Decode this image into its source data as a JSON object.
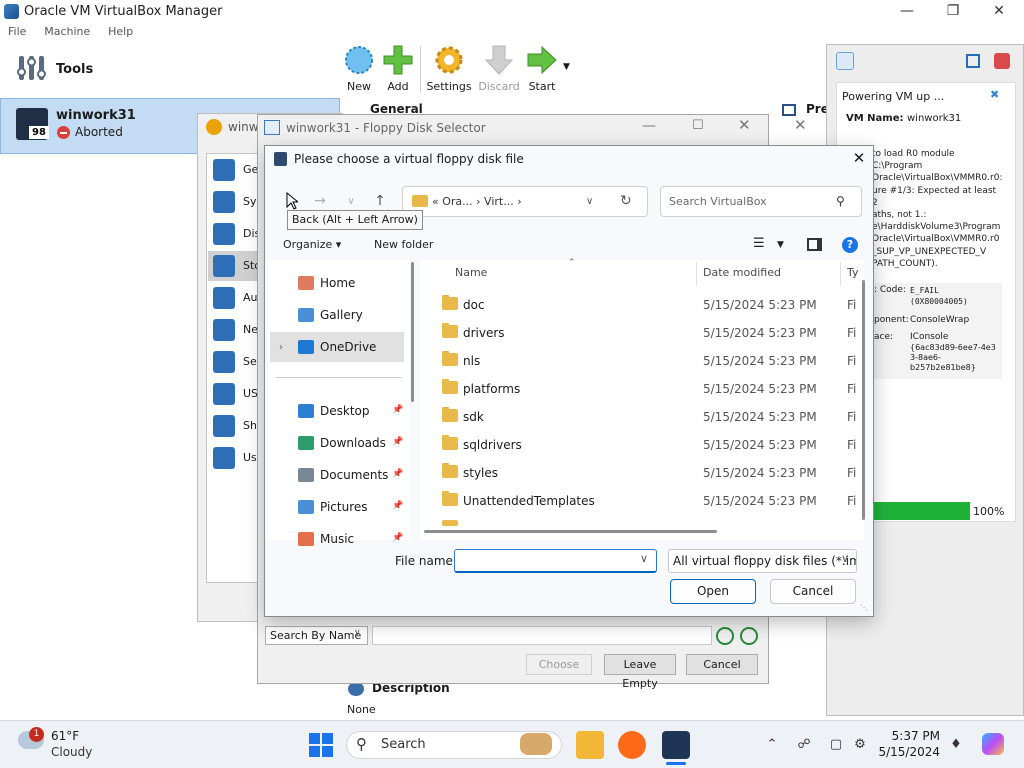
{
  "vbox": {
    "title": "Oracle VM VirtualBox Manager",
    "menu": [
      "File",
      "Machine",
      "Help"
    ],
    "tools_label": "Tools",
    "vm": {
      "name": "winwork31",
      "status": "Aborted",
      "os_badge": "98"
    },
    "toolbar": {
      "new": "New",
      "add": "Add",
      "settings": "Settings",
      "discard": "Discard",
      "start": "Start"
    },
    "general_label": "General",
    "preview_label": "Prev",
    "description_label": "Description",
    "description_value": "None"
  },
  "notification": {
    "title": "Powering VM up ...",
    "vm_label": "VM Name:",
    "vm_name": "winwork31",
    "message": "to load R0 module C:\\Program\nOracle\\VirtualBox\\VMMR0.r0:\nure #1/3: Expected at least 2\naths, not 1.:\ne\\HarddiskVolume3\\Program\nOracle\\VirtualBox\\VMMR0.r0\n_SUP_VP_UNEXPECTED_V\nPATH_COUNT).\n\nto load VMMR0.r0\n_SUP_VP_UNEXPECTED_V\nPATH_COUNT).",
    "details": {
      "code_label": ": Code:",
      "code_value": "E_FAIL",
      "code_hex": "(0X80004005)",
      "component_label": "ponent:",
      "component_value": "ConsoleWrap",
      "iface_label": "ace:",
      "iface_value": "IConsole",
      "iface_guid": "{6ac83d89-6ee7-4e3\n3-8ae6-\nb257b2e81be8}"
    },
    "progress": 100,
    "progress_label": "100%"
  },
  "settings_dialog": {
    "title": "winw",
    "items": [
      "Ge",
      "Sys",
      "Dis",
      "Sto",
      "Au",
      "Ne",
      "Se",
      "US",
      "Sha",
      "Us"
    ],
    "selected_index": 3
  },
  "floppy_dialog": {
    "title": "winwork31 - Floppy Disk Selector",
    "search_mode": "Search By Name",
    "choose_label": "Choose",
    "leave_empty_label": "Leave Empty",
    "cancel_label": "Cancel"
  },
  "chooser": {
    "title": "Please choose a virtual floppy disk file",
    "address": "« Ora... › Virt... ›",
    "search_placeholder": "Search VirtualBox",
    "tooltip": "Back (Alt + Left Arrow)",
    "organize": "Organize ▾",
    "new_folder": "New folder",
    "nav": [
      {
        "label": "Home",
        "icon": "home-icon",
        "color": "#e07a5f",
        "pinned": false
      },
      {
        "label": "Gallery",
        "icon": "gallery-icon",
        "color": "#4a8fd6",
        "pinned": false
      },
      {
        "label": "OneDrive",
        "icon": "cloud-icon",
        "color": "#1e78d3",
        "pinned": false
      },
      {
        "label": "Desktop",
        "icon": "desktop-icon",
        "color": "#2d7fd3",
        "pinned": true
      },
      {
        "label": "Downloads",
        "icon": "download-icon",
        "color": "#2e9b6a",
        "pinned": true
      },
      {
        "label": "Documents",
        "icon": "document-icon",
        "color": "#7a8796",
        "pinned": true
      },
      {
        "label": "Pictures",
        "icon": "pictures-icon",
        "color": "#4a8fd6",
        "pinned": true
      },
      {
        "label": "Music",
        "icon": "music-icon",
        "color": "#e36f4c",
        "pinned": true
      }
    ],
    "columns": {
      "name": "Name",
      "date": "Date modified",
      "type": "Ty"
    },
    "files": [
      {
        "name": "doc",
        "date": "5/15/2024 5:23 PM",
        "type": "Fi"
      },
      {
        "name": "drivers",
        "date": "5/15/2024 5:23 PM",
        "type": "Fi"
      },
      {
        "name": "nls",
        "date": "5/15/2024 5:23 PM",
        "type": "Fi"
      },
      {
        "name": "platforms",
        "date": "5/15/2024 5:23 PM",
        "type": "Fi"
      },
      {
        "name": "sdk",
        "date": "5/15/2024 5:23 PM",
        "type": "Fi"
      },
      {
        "name": "sqldrivers",
        "date": "5/15/2024 5:23 PM",
        "type": "Fi"
      },
      {
        "name": "styles",
        "date": "5/15/2024 5:23 PM",
        "type": "Fi"
      },
      {
        "name": "UnattendedTemplates",
        "date": "5/15/2024 5:23 PM",
        "type": "Fi"
      }
    ],
    "file_name_label": "File name:",
    "file_name_value": "",
    "filter": "All virtual floppy disk files (*.im",
    "open_label": "Open",
    "cancel_label": "Cancel"
  },
  "taskbar": {
    "weather_badge": "1",
    "temperature": "61°F",
    "weather": "Cloudy",
    "search_label": "Search",
    "time": "5:37 PM",
    "date": "5/15/2024"
  }
}
